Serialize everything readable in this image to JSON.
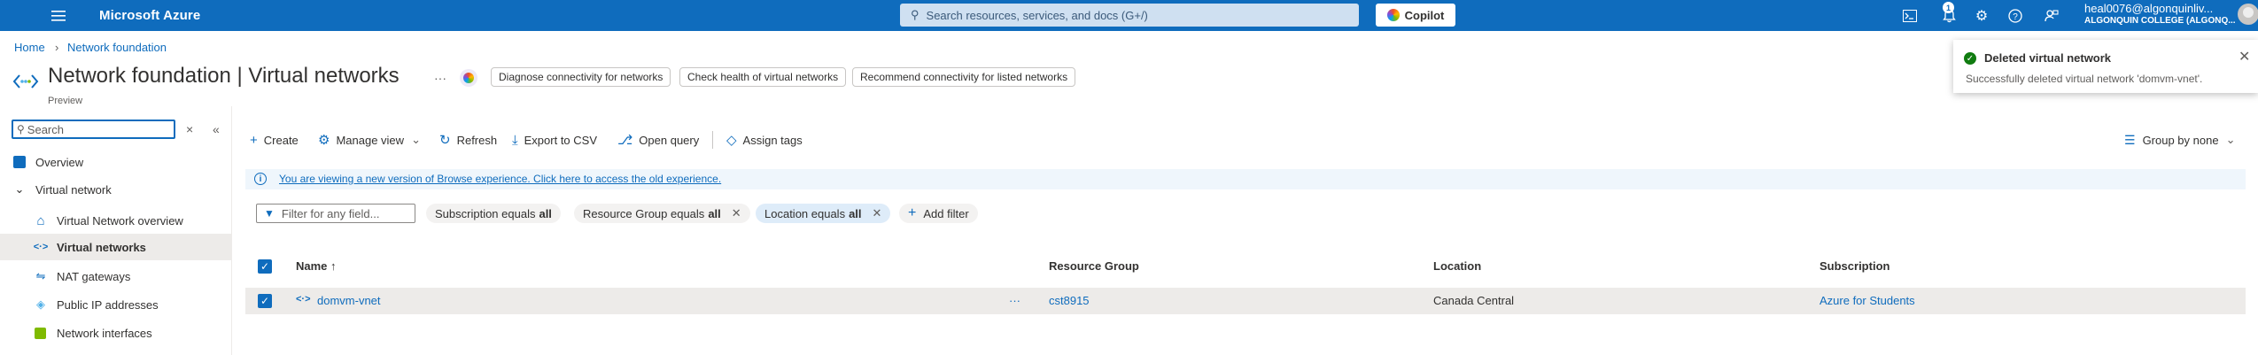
{
  "topbar": {
    "brand": "Microsoft Azure",
    "search_placeholder": "Search resources, services, and docs (G+/)",
    "copilot_label": "Copilot",
    "notification_count": "1",
    "account_email": "heal0076@algonquinliv...",
    "account_org": "ALGONQUIN COLLEGE (ALGONQ...",
    "colors": {
      "bar": "#0f6cbd"
    }
  },
  "breadcrumb": {
    "home": "Home",
    "sep": ">",
    "current": "Network foundation"
  },
  "header": {
    "title_main": "Network foundation",
    "title_sub": " | Virtual networks",
    "preview": "Preview",
    "more": "···",
    "actions": [
      "Diagnose connectivity for networks",
      "Check health of virtual networks",
      "Recommend connectivity for listed networks"
    ]
  },
  "notification": {
    "title": "Deleted virtual network",
    "message": "Successfully deleted virtual network 'domvm-vnet'.",
    "status_color": "#107c10"
  },
  "sidebar": {
    "search_placeholder": "Search",
    "items": [
      {
        "label": "Overview"
      },
      {
        "label": "Virtual network"
      },
      {
        "label": "Virtual Network overview"
      },
      {
        "label": "Virtual networks"
      },
      {
        "label": "NAT gateways"
      },
      {
        "label": "Public IP addresses"
      },
      {
        "label": "Network interfaces"
      }
    ]
  },
  "toolbar": {
    "create": "Create",
    "manage_view": "Manage view",
    "refresh": "Refresh",
    "export_csv": "Export to CSV",
    "open_query": "Open query",
    "assign_tags": "Assign tags",
    "group_by": "Group by none"
  },
  "infobar": {
    "text": "You are viewing a new version of Browse experience. Click here to access the old experience."
  },
  "filters": {
    "placeholder": "Filter for any field...",
    "chips": [
      {
        "label": "Subscription equals",
        "value": "all"
      },
      {
        "label": "Resource Group equals",
        "value": "all"
      },
      {
        "label": "Location equals",
        "value": "all"
      }
    ],
    "add_filter": "Add filter"
  },
  "table": {
    "headers": {
      "name": "Name ↑",
      "resource_group": "Resource Group",
      "location": "Location",
      "subscription": "Subscription"
    },
    "rows": [
      {
        "name": "domvm-vnet",
        "actions": "···",
        "resource_group": "cst8915",
        "location": "Canada Central",
        "subscription": "Azure for Students"
      }
    ]
  }
}
